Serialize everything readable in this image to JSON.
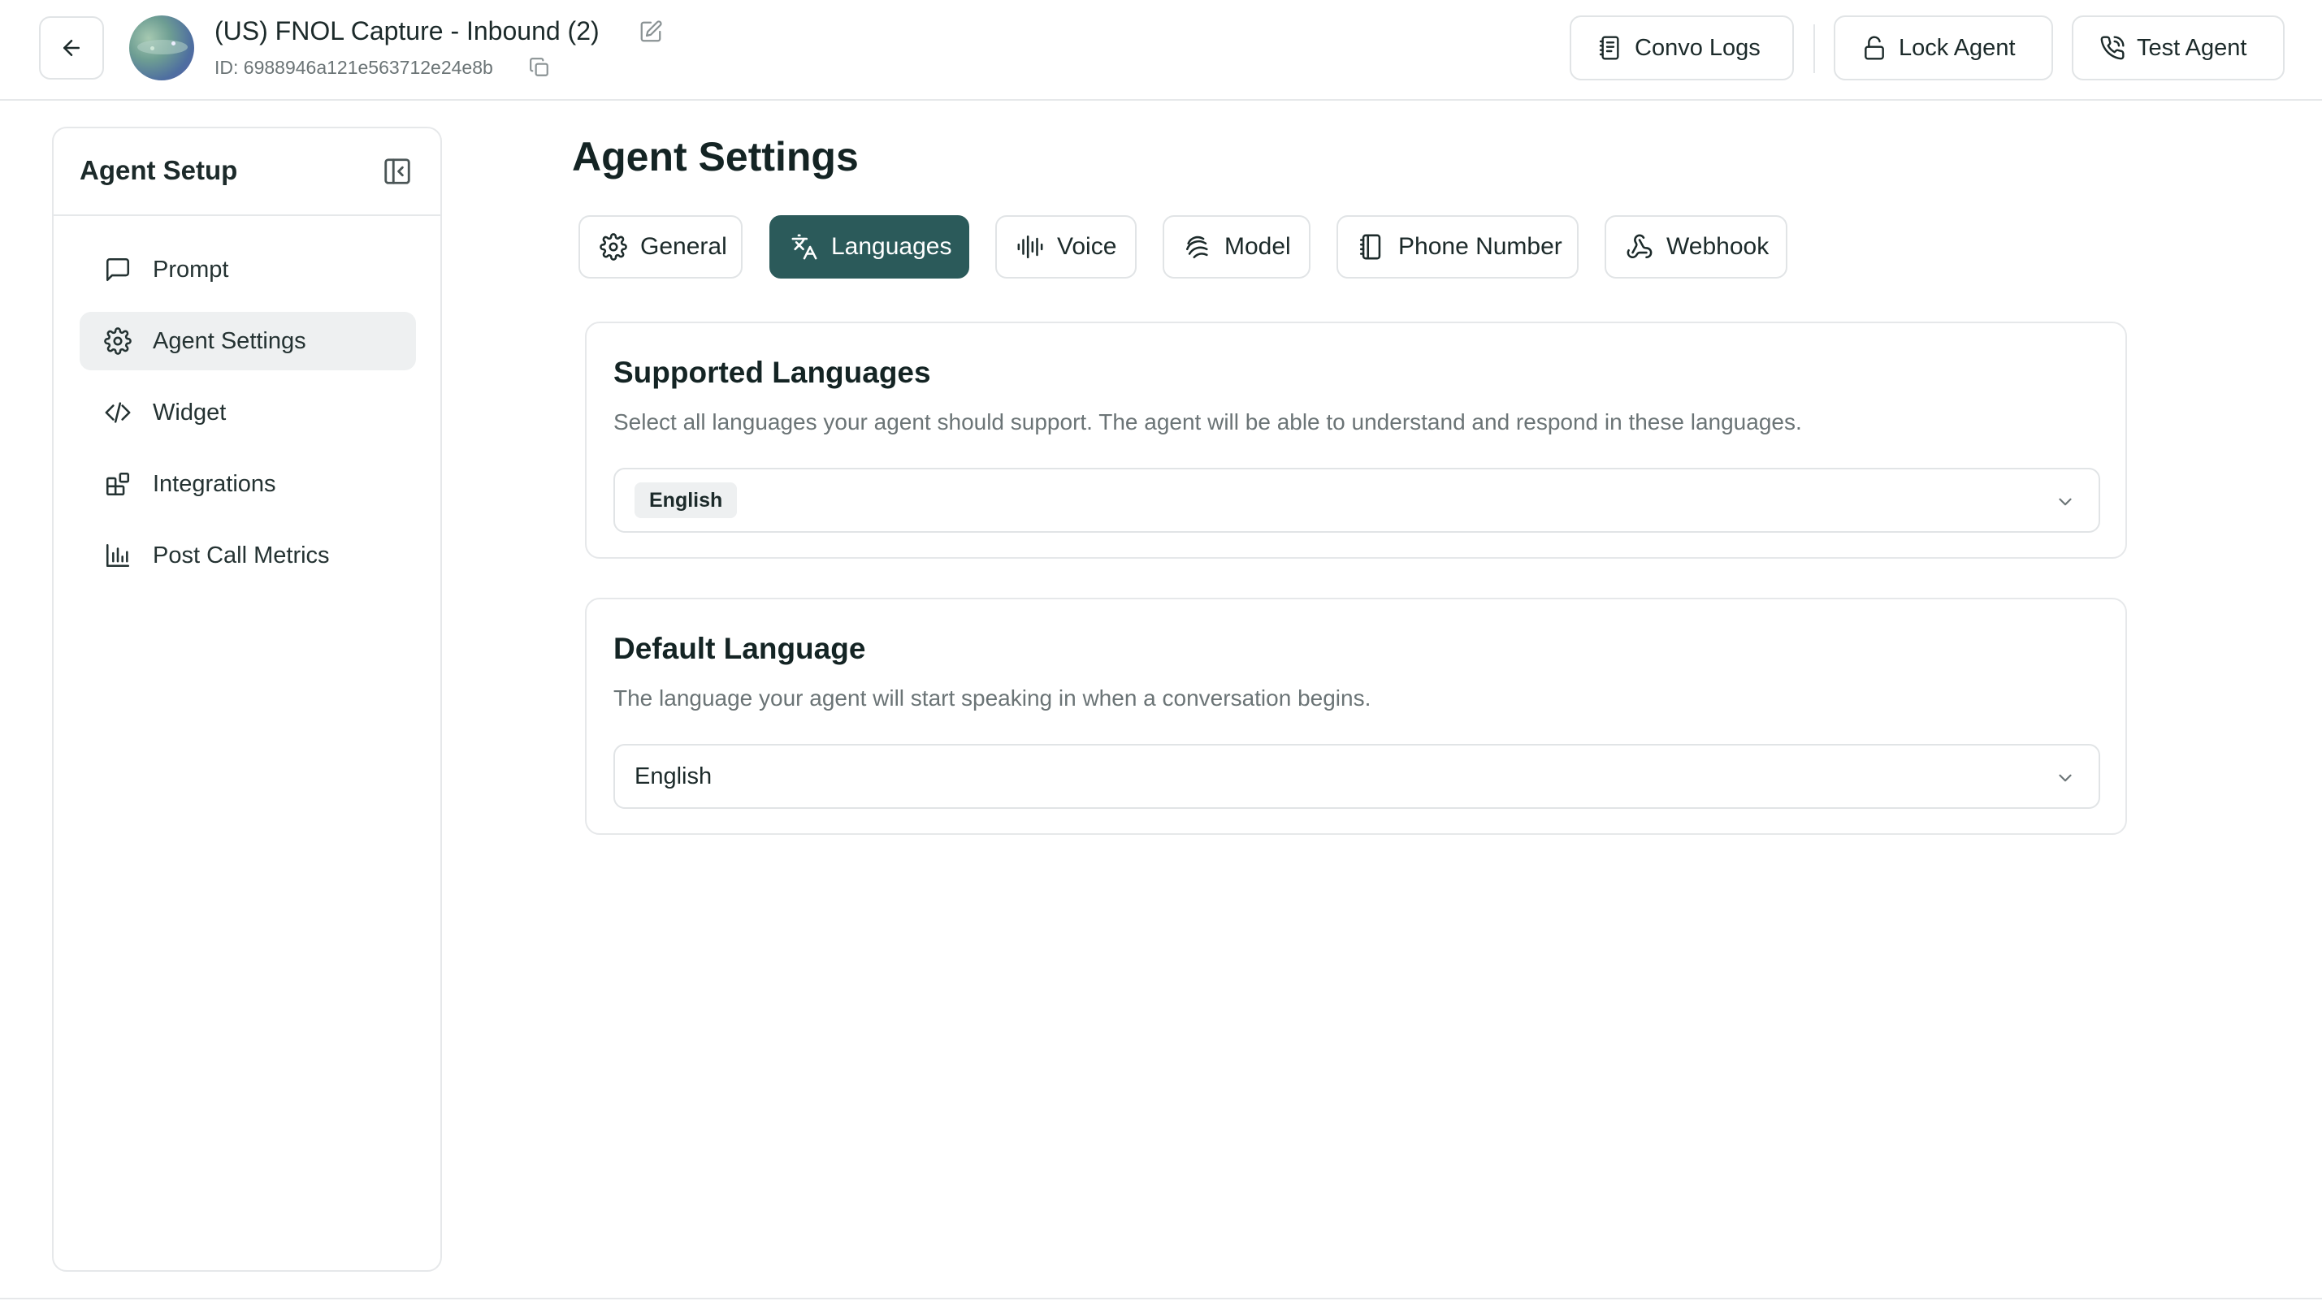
{
  "header": {
    "agent_title": "(US) FNOL Capture - Inbound (2)",
    "agent_id": "ID: 6988946a121e563712e24e8b",
    "buttons": {
      "convo_logs": "Convo Logs",
      "lock_agent": "Lock Agent",
      "test_agent": "Test Agent"
    }
  },
  "sidebar": {
    "title": "Agent Setup",
    "items": [
      {
        "label": "Prompt",
        "icon": "message-square-icon"
      },
      {
        "label": "Agent Settings",
        "icon": "gear-icon",
        "active": true
      },
      {
        "label": "Widget",
        "icon": "code-icon"
      },
      {
        "label": "Integrations",
        "icon": "blocks-icon"
      },
      {
        "label": "Post Call Metrics",
        "icon": "bar-chart-icon"
      }
    ]
  },
  "main": {
    "title": "Agent Settings",
    "tabs": [
      {
        "label": "General",
        "icon": "gear-icon"
      },
      {
        "label": "Languages",
        "icon": "languages-icon",
        "active": true
      },
      {
        "label": "Voice",
        "icon": "audio-wave-icon"
      },
      {
        "label": "Model",
        "icon": "model-icon"
      },
      {
        "label": "Phone Number",
        "icon": "notebook-icon"
      },
      {
        "label": "Webhook",
        "icon": "webhook-icon"
      }
    ],
    "supported_languages": {
      "title": "Supported Languages",
      "description": "Select all languages your agent should support. The agent will be able to understand and respond in these languages.",
      "selected": [
        "English"
      ]
    },
    "default_language": {
      "title": "Default Language",
      "description": "The language your agent will start speaking in when a conversation begins.",
      "value": "English"
    }
  },
  "colors": {
    "accent": "#2b5a5a",
    "border": "#e1e4e6",
    "muted_text": "#6b7476",
    "active_bg": "#eef0f1"
  }
}
